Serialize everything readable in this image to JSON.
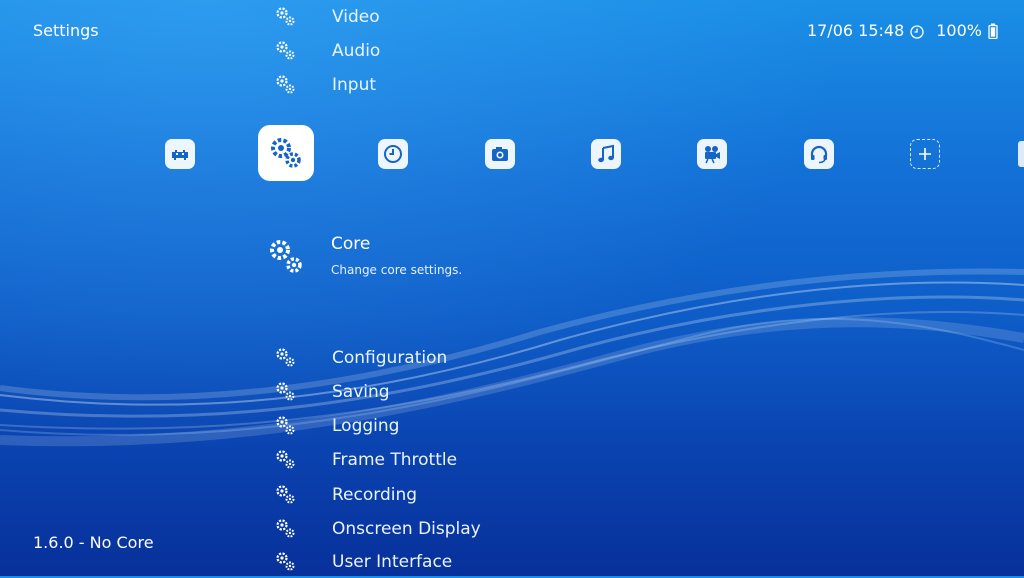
{
  "header": {
    "title": "Settings",
    "datetime": "17/06 15:48",
    "battery": "100%"
  },
  "footer": {
    "version": "1.6.0 - No Core"
  },
  "menu_above": [
    {
      "label": "Video",
      "icon": "gear-icon"
    },
    {
      "label": "Audio",
      "icon": "gear-icon"
    },
    {
      "label": "Input",
      "icon": "gear-icon"
    }
  ],
  "categories": [
    {
      "name": "main-menu",
      "icon": "retroarch-invader-icon"
    },
    {
      "name": "settings",
      "icon": "settings-gear-icon",
      "selected": true
    },
    {
      "name": "history",
      "icon": "clock-icon"
    },
    {
      "name": "images",
      "icon": "camera-icon"
    },
    {
      "name": "music",
      "icon": "music-note-icon"
    },
    {
      "name": "videos",
      "icon": "film-camera-icon"
    },
    {
      "name": "netplay",
      "icon": "headset-icon"
    },
    {
      "name": "add",
      "icon": "add-plus-icon"
    }
  ],
  "selected_item": {
    "title": "Core",
    "subtitle": "Change core settings."
  },
  "menu_below": [
    {
      "label": "Configuration"
    },
    {
      "label": "Saving"
    },
    {
      "label": "Logging"
    },
    {
      "label": "Frame Throttle"
    },
    {
      "label": "Recording"
    },
    {
      "label": "Onscreen Display"
    },
    {
      "label": "User Interface"
    }
  ],
  "colors": {
    "background_top": "#1a8fe6",
    "background_bottom": "#08309a",
    "icon_fill": "#ffffff",
    "icon_glyph": "#1565c8"
  }
}
